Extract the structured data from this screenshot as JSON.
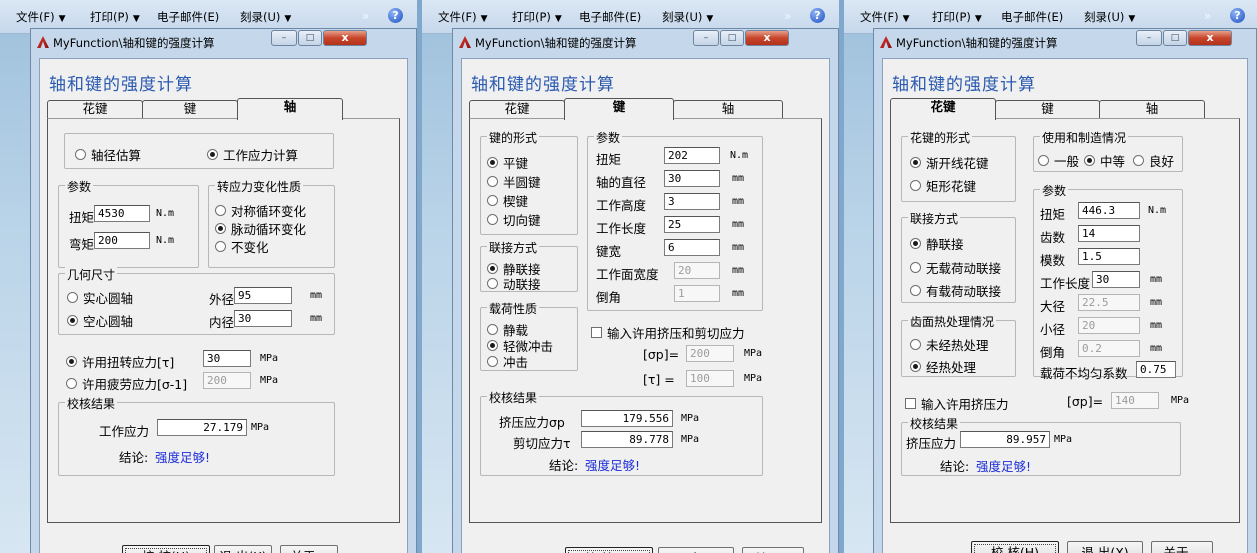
{
  "menu": {
    "file": "文件(F)",
    "print": "打印(P)",
    "email": "电子邮件(E)",
    "burn": "刻录(U)",
    "more": "»",
    "help": "?"
  },
  "window": {
    "title": "MyFunction\\轴和键的强度计算",
    "heading": "轴和键的强度计算",
    "minimize": "–",
    "maximize": "□",
    "close": "x"
  },
  "tabs": {
    "spline": "花键",
    "key": "键",
    "shaft": "轴"
  },
  "buttons": {
    "check": "校  核(H)",
    "exit": "退 出(X)",
    "about": "关于..."
  },
  "conclusion_label": "结论:",
  "shaft": {
    "mode_estimate": "轴径估算",
    "mode_stress": "工作应力计算",
    "params_legend": "参数",
    "torque_label": "扭矩",
    "torque_value": "4530",
    "torque_unit": "N.m",
    "bending_label": "弯矩",
    "bending_value": "200",
    "bending_unit": "N.m",
    "stress_change_legend": "转应力变化性质",
    "sym": "对称循环变化",
    "pulse": "脉动循环变化",
    "const": "不变化",
    "geometry_legend": "几何尺寸",
    "solid": "实心圆轴",
    "hollow": "空心圆轴",
    "outer_label": "外径",
    "outer_value": "95",
    "outer_unit": "mm",
    "inner_label": "内径",
    "inner_value": "30",
    "inner_unit": "mm",
    "allow_torsion": "许用扭转应力[τ]",
    "allow_torsion_value": "30",
    "allow_torsion_unit": "MPa",
    "allow_fatigue": "许用疲劳应力[σ-1]",
    "allow_fatigue_value": "200",
    "allow_fatigue_unit": "MPa",
    "result_legend": "校核结果",
    "work_stress_label": "工作应力",
    "work_stress_value": "27.179",
    "work_stress_unit": "MPa",
    "conclusion": "强度足够!"
  },
  "key": {
    "form_legend": "键的形式",
    "flat": "平键",
    "half": "半圆键",
    "wedge": "楔键",
    "tangent": "切向键",
    "params_legend": "参数",
    "torque_label": "扭矩",
    "torque_value": "202",
    "torque_unit": "N.m",
    "diameter_label": "轴的直径",
    "diameter_value": "30",
    "diameter_unit": "mm",
    "height_label": "工作高度",
    "height_value": "3",
    "height_unit": "mm",
    "length_label": "工作长度",
    "length_value": "25",
    "length_unit": "mm",
    "width_label": "键宽",
    "width_value": "6",
    "width_unit": "mm",
    "face_label": "工作面宽度",
    "face_value": "20",
    "face_unit": "mm",
    "chamfer_label": "倒角",
    "chamfer_value": "1",
    "chamfer_unit": "mm",
    "conn_legend": "联接方式",
    "static": "静联接",
    "dynamic": "动联接",
    "load_legend": "载荷性质",
    "static_load": "静载",
    "light": "轻微冲击",
    "impact": "冲击",
    "input_allow": "输入许用挤压和剪切应力",
    "sp_label": "[σp]=",
    "sp_value": "200",
    "sp_unit": "MPa",
    "tau_label": "[τ] =",
    "tau_value": "100",
    "tau_unit": "MPa",
    "result_legend": "校核结果",
    "crush_label": "挤压应力σp",
    "crush_value": "179.556",
    "crush_unit": "MPa",
    "shear_label": "剪切应力τ",
    "shear_value": "89.778",
    "shear_unit": "MPa",
    "conclusion": "强度足够!"
  },
  "spline": {
    "form_legend": "花键的形式",
    "involute": "渐开线花键",
    "rect": "矩形花键",
    "usage_legend": "使用和制造情况",
    "normal": "一般",
    "medium": "中等",
    "good": "良好",
    "params_legend": "参数",
    "torque_label": "扭矩",
    "torque_value": "446.3",
    "torque_unit": "N.m",
    "teeth_label": "齿数",
    "teeth_value": "14",
    "module_label": "模数",
    "module_value": "1.5",
    "length_label": "工作长度",
    "length_value": "30",
    "length_unit": "mm",
    "major_label": "大径",
    "major_value": "22.5",
    "major_unit": "mm",
    "minor_label": "小径",
    "minor_value": "20",
    "minor_unit": "mm",
    "chamfer_label": "倒角",
    "chamfer_value": "0.2",
    "chamfer_unit": "mm",
    "uneven_label": "载荷不均匀系数",
    "uneven_value": "0.75",
    "conn_legend": "联接方式",
    "static": "静联接",
    "dyn_noload": "无载荷动联接",
    "dyn_load": "有载荷动联接",
    "heat_legend": "齿面热处理情况",
    "noheat": "未经热处理",
    "heat": "经热处理",
    "input_allow": "输入许用挤压力",
    "sp_label": "[σp]=",
    "sp_value": "140",
    "sp_unit": "MPa",
    "result_legend": "校核结果",
    "crush_label": "挤压应力",
    "crush_value": "89.957",
    "crush_unit": "MPa",
    "conclusion": "强度足够!"
  }
}
